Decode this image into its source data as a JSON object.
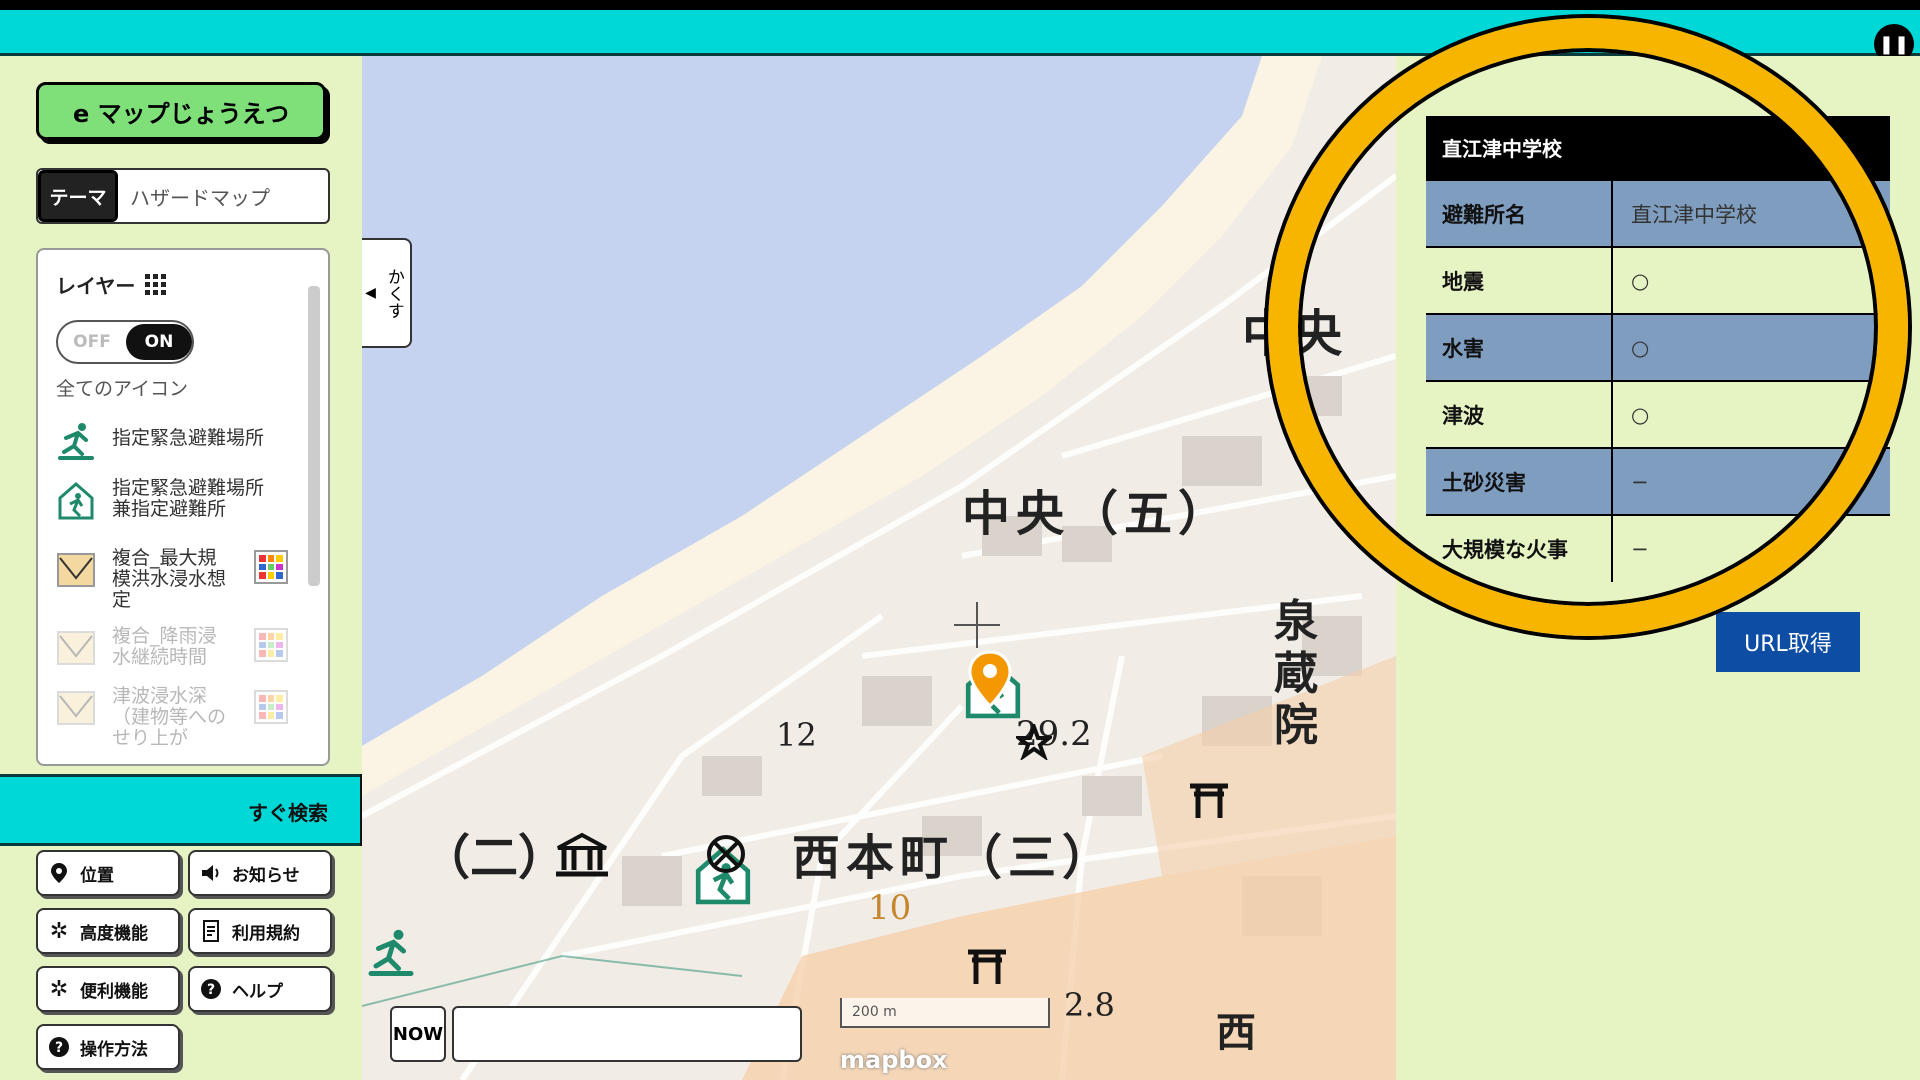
{
  "app": {
    "logo": "e マップじょうえつ",
    "pause_icon": "pause-icon"
  },
  "theme": {
    "tag": "テーマ",
    "value": "ハザードマップ"
  },
  "layers": {
    "title": "レイヤー",
    "toggle_off": "OFF",
    "toggle_on": "ON",
    "all_icons": "全てのアイコン",
    "items": [
      {
        "label": "指定緊急避難場所",
        "icon": "evacuation-site-icon"
      },
      {
        "label": "指定緊急避難場所兼指定避難所",
        "icon": "shelter-icon"
      },
      {
        "label": "複合_最大規模洪水浸水想定",
        "icon": "flood-map-icon"
      },
      {
        "label": "複合_降雨浸水継続時間",
        "icon": "rain-flood-map-icon"
      },
      {
        "label": "津波浸水深（建物等へのせり上が",
        "icon": "tsunami-map-icon"
      }
    ]
  },
  "search": {
    "label": "すぐ検索"
  },
  "menu": {
    "location": "位置",
    "notice": "お知らせ",
    "advanced": "高度機能",
    "terms": "利用規約",
    "convenient": "便利機能",
    "help": "ヘルプ",
    "howto": "操作方法"
  },
  "map": {
    "hide_tab": "かくす",
    "now": "NOW",
    "scale": "200 m",
    "attribution": "mapbox",
    "labels": {
      "chuo5": "中央（五）",
      "chuo": "中央",
      "nishihoncho": "西本町（三）",
      "ni": "（二）",
      "senzoin": "泉蔵院",
      "elev1": "12",
      "elev2": "29.2",
      "elev3": "2.8",
      "contour": "10",
      "nishi": "西"
    }
  },
  "facility": {
    "name": "直江津中学校",
    "rows": [
      {
        "key": "避難所名",
        "value": "直江津中学校"
      },
      {
        "key": "地震",
        "value": "○"
      },
      {
        "key": "水害",
        "value": "○"
      },
      {
        "key": "津波",
        "value": "○"
      },
      {
        "key": "土砂災害",
        "value": "−"
      },
      {
        "key": "大規模な火事",
        "value": "−"
      }
    ],
    "url_button": "URL取得"
  },
  "colors": {
    "accent": "#00d8d8",
    "logo_green": "#7fe07a",
    "highlight_ring": "#f7b500",
    "table_row_dark": "#7f9dbf",
    "url_button": "#0d4da3",
    "sea": "#c5d3f0"
  }
}
